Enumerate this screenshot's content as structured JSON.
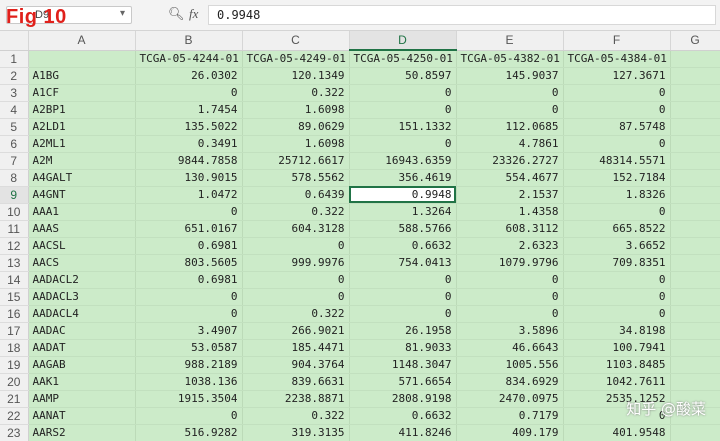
{
  "toolbar": {
    "name_box": "D9",
    "fig_label": "Fig 10",
    "formula_value": "0.9948"
  },
  "columns": [
    "A",
    "B",
    "C",
    "D",
    "E",
    "F",
    "G"
  ],
  "active_column": "D",
  "active_row": 9,
  "header_row": [
    "",
    "TCGA-05-4244-01",
    "TCGA-05-4249-01",
    "TCGA-05-4250-01",
    "TCGA-05-4382-01",
    "TCGA-05-4384-01",
    ""
  ],
  "rows": [
    [
      "A1BG",
      "26.0302",
      "120.1349",
      "50.8597",
      "145.9037",
      "127.3671",
      ""
    ],
    [
      "A1CF",
      "0",
      "0.322",
      "0",
      "0",
      "0",
      ""
    ],
    [
      "A2BP1",
      "1.7454",
      "1.6098",
      "0",
      "0",
      "0",
      ""
    ],
    [
      "A2LD1",
      "135.5022",
      "89.0629",
      "151.1332",
      "112.0685",
      "87.5748",
      ""
    ],
    [
      "A2ML1",
      "0.3491",
      "1.6098",
      "0",
      "4.7861",
      "0",
      ""
    ],
    [
      "A2M",
      "9844.7858",
      "25712.6617",
      "16943.6359",
      "23326.2727",
      "48314.5571",
      ""
    ],
    [
      "A4GALT",
      "130.9015",
      "578.5562",
      "356.4619",
      "554.4677",
      "152.7184",
      ""
    ],
    [
      "A4GNT",
      "1.0472",
      "0.6439",
      "0.9948",
      "2.1537",
      "1.8326",
      ""
    ],
    [
      "AAA1",
      "0",
      "0.322",
      "1.3264",
      "1.4358",
      "0",
      ""
    ],
    [
      "AAAS",
      "651.0167",
      "604.3128",
      "588.5766",
      "608.3112",
      "665.8522",
      ""
    ],
    [
      "AACSL",
      "0.6981",
      "0",
      "0.6632",
      "2.6323",
      "3.6652",
      ""
    ],
    [
      "AACS",
      "803.5605",
      "999.9976",
      "754.0413",
      "1079.9796",
      "709.8351",
      ""
    ],
    [
      "AADACL2",
      "0.6981",
      "0",
      "0",
      "0",
      "0",
      ""
    ],
    [
      "AADACL3",
      "0",
      "0",
      "0",
      "0",
      "0",
      ""
    ],
    [
      "AADACL4",
      "0",
      "0.322",
      "0",
      "0",
      "0",
      ""
    ],
    [
      "AADAC",
      "3.4907",
      "266.9021",
      "26.1958",
      "3.5896",
      "34.8198",
      ""
    ],
    [
      "AADAT",
      "53.0587",
      "185.4471",
      "81.9033",
      "46.6643",
      "100.7941",
      ""
    ],
    [
      "AAGAB",
      "988.2189",
      "904.3764",
      "1148.3047",
      "1005.556",
      "1103.8485",
      ""
    ],
    [
      "AAK1",
      "1038.136",
      "839.6631",
      "571.6654",
      "834.6929",
      "1042.7611",
      ""
    ],
    [
      "AAMP",
      "1915.3504",
      "2238.8871",
      "2808.9198",
      "2470.0975",
      "2535.1252",
      ""
    ],
    [
      "AANAT",
      "0",
      "0.322",
      "0.6632",
      "0.7179",
      "0",
      ""
    ],
    [
      "AARS2",
      "516.9282",
      "319.3135",
      "411.8246",
      "409.179",
      "401.9548",
      ""
    ],
    [
      "AARSD1",
      "472.2925",
      "500.6427",
      "625.715",
      "456.353",
      "403.7874",
      ""
    ]
  ],
  "watermark": "知乎 @酸菜",
  "colors": {
    "cell_fill": "#ccebc9",
    "selection": "#217346",
    "fig_label": "#e0201b"
  }
}
